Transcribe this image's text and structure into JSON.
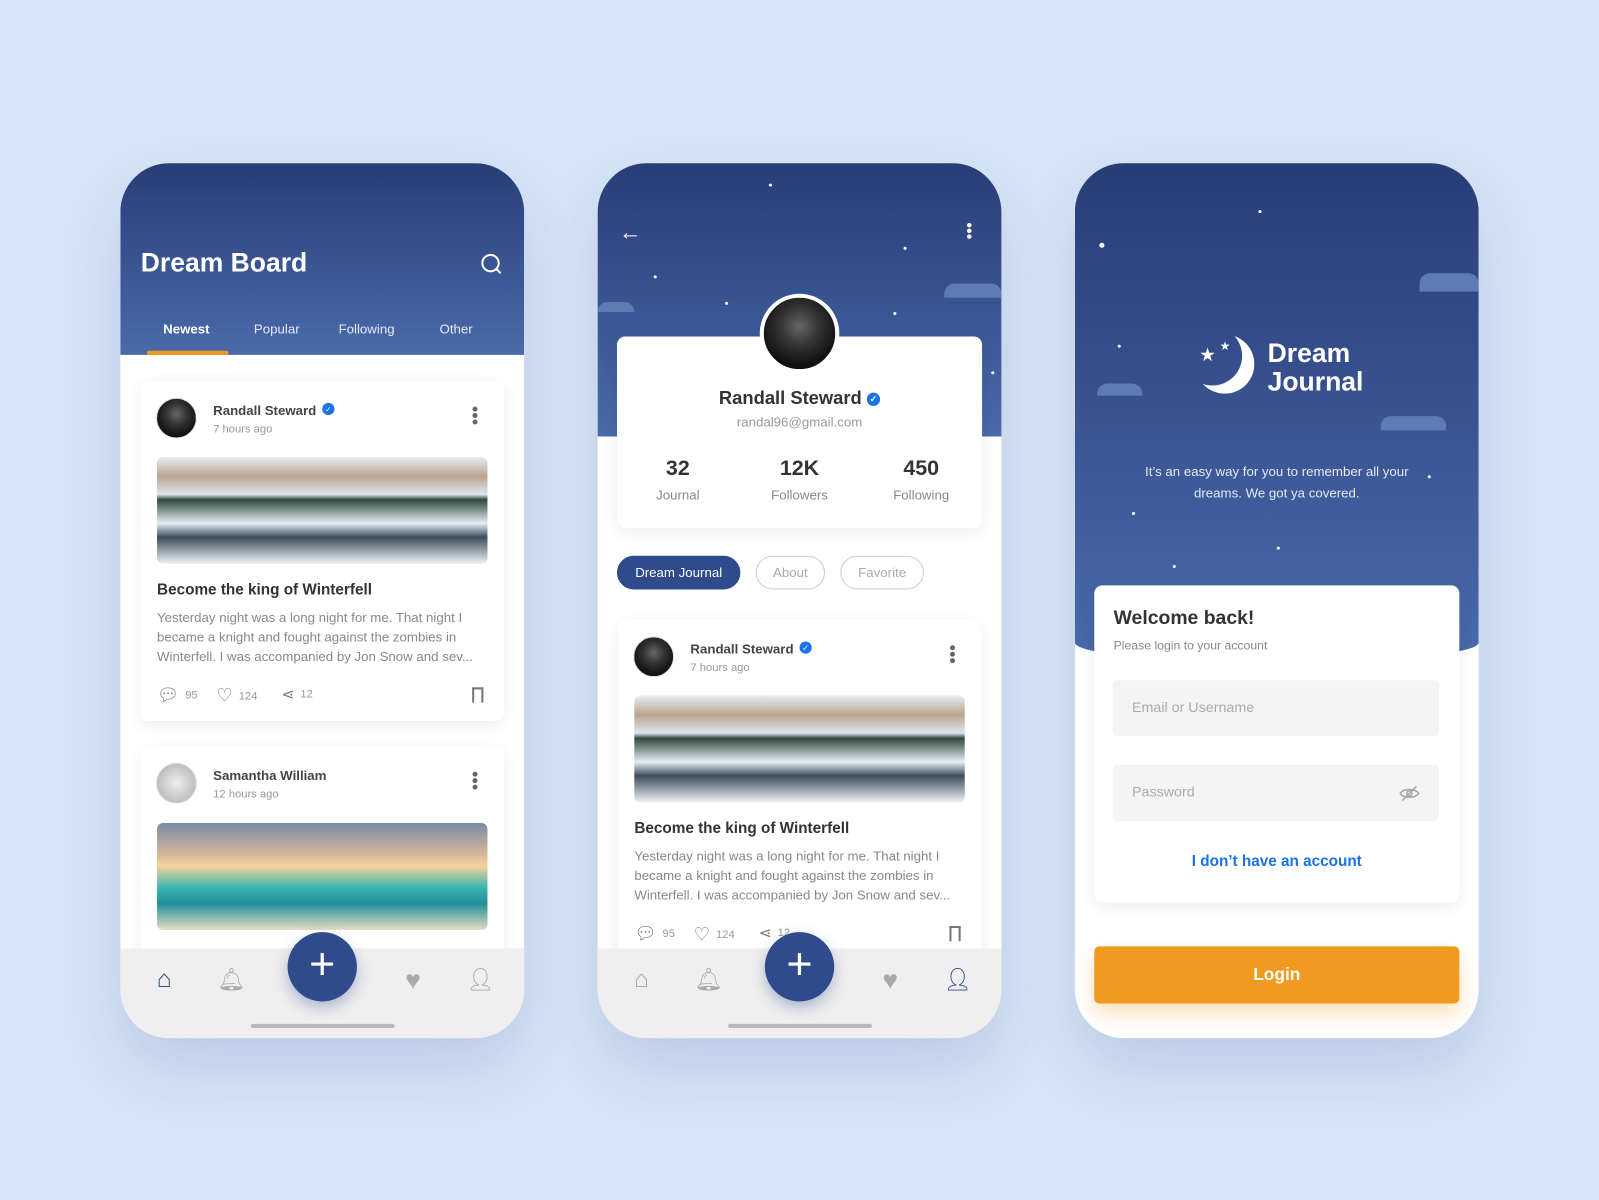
{
  "colors": {
    "primary": "#2f4b8c",
    "accent": "#f09a1f",
    "link": "#1a73e8",
    "verified": "#1a73e8",
    "background": "#d8e4f7"
  },
  "board": {
    "title": "Dream Board",
    "tabs": [
      {
        "label": "Newest",
        "active": true
      },
      {
        "label": "Popular"
      },
      {
        "label": "Following"
      },
      {
        "label": "Other"
      }
    ],
    "posts": [
      {
        "author": "Randall Steward",
        "verified": true,
        "time": "7 hours ago",
        "title": "Become the king of Winterfell",
        "body": "Yesterday night was a long night for me. That night I became a knight and fought against the zombies in Winterfell. I was accompanied by Jon Snow and sev...",
        "comments": "95",
        "likes": "124",
        "shares": "12"
      },
      {
        "author": "Samantha William",
        "time": "12 hours ago"
      }
    ]
  },
  "profile": {
    "name": "Randall Steward",
    "verified": true,
    "email": "randal96@gmail.com",
    "stats": [
      {
        "value": "32",
        "label": "Journal"
      },
      {
        "value": "12K",
        "label": "Followers"
      },
      {
        "value": "450",
        "label": "Following"
      }
    ],
    "tabs": [
      {
        "label": "Dream Journal",
        "active": true
      },
      {
        "label": "About"
      },
      {
        "label": "Favorite"
      }
    ],
    "post": {
      "author": "Randall Steward",
      "time": "7 hours ago",
      "title": "Become the king of Winterfell",
      "body": "Yesterday night was a long night for me. That night I became a knight and fought against the zombies in Winterfell. I was accompanied by Jon Snow and sev...",
      "comments": "95",
      "likes": "124",
      "shares": "12"
    }
  },
  "login": {
    "logo_line1": "Dream",
    "logo_line2": "Journal",
    "tagline": "It’s an easy way for you to remember all your dreams. We got ya covered.",
    "welcome": "Welcome back!",
    "subtitle": "Please login to your account",
    "email_placeholder": "Email or Username",
    "password_placeholder": "Password",
    "no_account": "I don’t have an account",
    "login_label": "Login"
  },
  "nav": {
    "active_phone1": "home",
    "active_phone2": "profile"
  }
}
